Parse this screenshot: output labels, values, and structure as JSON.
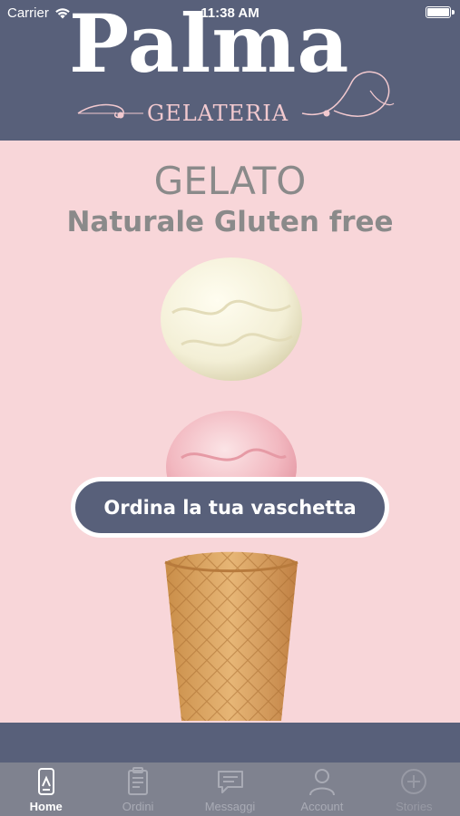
{
  "status_bar": {
    "carrier": "Carrier",
    "time": "11:38 AM"
  },
  "brand": {
    "name": "Palma",
    "subtitle": "GELATERIA"
  },
  "hero": {
    "title": "GELATO",
    "subtitle": "Naturale Gluten free",
    "cta_label": "Ordina la tua vaschetta"
  },
  "tabs": [
    {
      "label": "Home",
      "icon": "phone-icon",
      "active": true
    },
    {
      "label": "Ordini",
      "icon": "clipboard-icon",
      "active": false
    },
    {
      "label": "Messaggi",
      "icon": "chat-icon",
      "active": false
    },
    {
      "label": "Account",
      "icon": "user-icon",
      "active": false
    },
    {
      "label": "Stories",
      "icon": "plus-circle-icon",
      "active": false
    }
  ],
  "colors": {
    "header": "#58607a",
    "hero_background": "#f8d6d9",
    "cta_background": "#58607a",
    "tabbar": "#7f828f",
    "tab_active": "#ffffff",
    "tab_inactive": "#a9abb5"
  }
}
